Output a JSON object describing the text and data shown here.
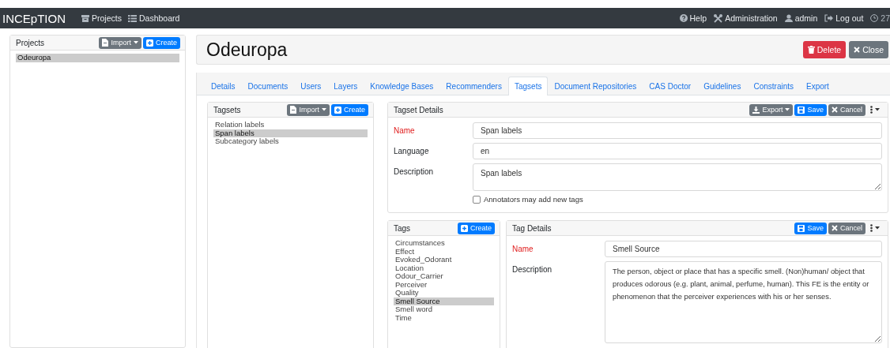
{
  "navbar": {
    "brand": "INCEpTION",
    "links": [
      {
        "label": "Projects",
        "kind": "projects"
      },
      {
        "label": "Dashboard",
        "kind": "dashboard"
      }
    ],
    "right": [
      {
        "label": "Help",
        "kind": "help"
      },
      {
        "label": "Administration",
        "kind": "admin"
      },
      {
        "label": "admin",
        "kind": "user"
      },
      {
        "label": "Log out",
        "kind": "logout"
      },
      {
        "label": "27",
        "kind": "timer"
      }
    ]
  },
  "projects_panel": {
    "title": "Projects",
    "buttons": [
      {
        "label": "Import",
        "kind": "import"
      },
      {
        "label": "Create",
        "kind": "create"
      }
    ],
    "items": [
      {
        "label": "Odeuropa",
        "selected": true
      }
    ]
  },
  "project": {
    "title": "Odeuropa",
    "buttons": [
      {
        "label": "Delete",
        "kind": "delete"
      },
      {
        "label": "Close",
        "kind": "close"
      }
    ]
  },
  "tabs": [
    {
      "label": "Details",
      "selected": false
    },
    {
      "label": "Documents",
      "selected": false
    },
    {
      "label": "Users",
      "selected": false
    },
    {
      "label": "Layers",
      "selected": false
    },
    {
      "label": "Knowledge Bases",
      "selected": false
    },
    {
      "label": "Recommenders",
      "selected": false
    },
    {
      "label": "Tagsets",
      "selected": true
    },
    {
      "label": "Document Repositories",
      "selected": false
    },
    {
      "label": "CAS Doctor",
      "selected": false
    },
    {
      "label": "Guidelines",
      "selected": false
    },
    {
      "label": "Constraints",
      "selected": false
    },
    {
      "label": "Export",
      "selected": false
    }
  ],
  "tagsets_panel": {
    "title": "Tagsets",
    "buttons": [
      {
        "label": "Import",
        "kind": "import"
      },
      {
        "label": "Create",
        "kind": "create"
      }
    ],
    "items": [
      {
        "label": "Relation labels",
        "selected": false
      },
      {
        "label": "Span labels",
        "selected": true
      },
      {
        "label": "Subcategory labels",
        "selected": false
      }
    ]
  },
  "tagset_details": {
    "title": "Tagset Details",
    "buttons": [
      {
        "label": "Export",
        "kind": "export"
      },
      {
        "label": "Save",
        "kind": "save"
      },
      {
        "label": "Cancel",
        "kind": "cancel"
      },
      {
        "kind": "more"
      }
    ],
    "fields": [
      {
        "label": "Name",
        "required": true,
        "kind": "input",
        "value": "Span labels"
      },
      {
        "label": "Language",
        "required": false,
        "kind": "input",
        "value": "en"
      },
      {
        "label": "Description",
        "required": false,
        "kind": "textarea",
        "value": "Span labels"
      }
    ],
    "checkbox": {
      "label": "Annotators may add new tags",
      "checked": false
    }
  },
  "tags_panel": {
    "title": "Tags",
    "buttons": [
      {
        "label": "Create",
        "kind": "create"
      }
    ],
    "items": [
      {
        "label": "Circumstances",
        "selected": false
      },
      {
        "label": "Effect",
        "selected": false
      },
      {
        "label": "Evoked_Odorant",
        "selected": false
      },
      {
        "label": "Location",
        "selected": false
      },
      {
        "label": "Odour_Carrier",
        "selected": false
      },
      {
        "label": "Perceiver",
        "selected": false
      },
      {
        "label": "Quality",
        "selected": false
      },
      {
        "label": "Smell Source",
        "selected": true
      },
      {
        "label": "Smell word",
        "selected": false
      },
      {
        "label": "Time",
        "selected": false
      }
    ]
  },
  "tag_details": {
    "title": "Tag Details",
    "buttons": [
      {
        "label": "Save",
        "kind": "save"
      },
      {
        "label": "Cancel",
        "kind": "cancel"
      },
      {
        "kind": "more"
      }
    ],
    "fields": [
      {
        "label": "Name",
        "required": true,
        "kind": "input",
        "value": "Smell Source"
      },
      {
        "label": "Description",
        "required": false,
        "kind": "textarea",
        "value": "The person, object or place that has a specific smell. (Non)human/ object that produces odorous (e.g. plant, animal, perfume, human). This FE is the entity or phenomenon that the perceiver experiences with his or her senses."
      }
    ]
  }
}
